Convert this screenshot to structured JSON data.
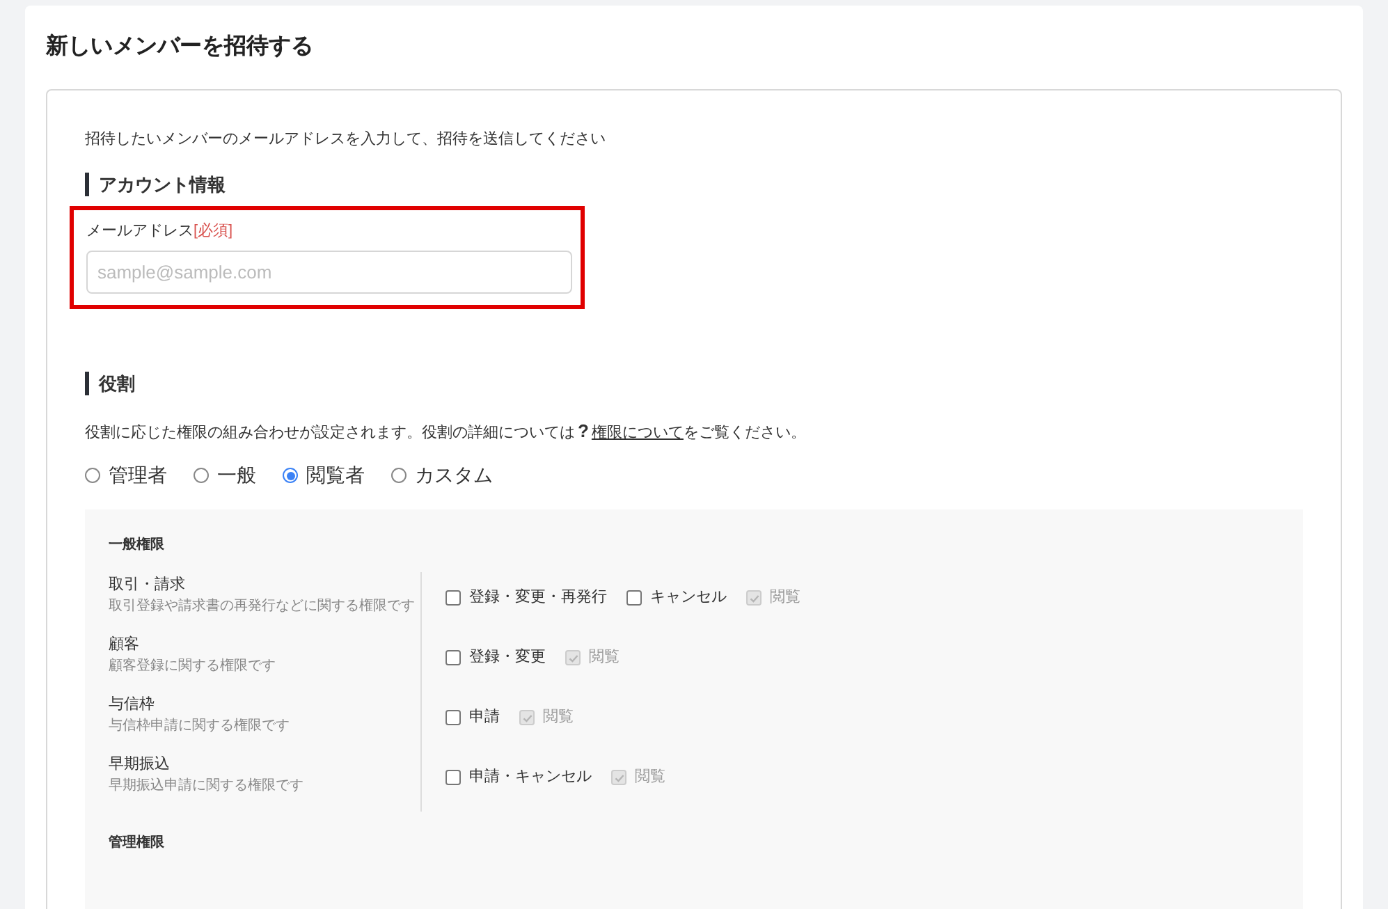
{
  "page": {
    "title": "新しいメンバーを招待する"
  },
  "intro": "招待したいメンバーのメールアドレスを入力して、招待を送信してください",
  "account": {
    "heading": "アカウント情報",
    "email": {
      "label": "メールアドレス",
      "required": "[必須]",
      "placeholder": "sample@sample.com",
      "highlighted": true
    }
  },
  "role": {
    "heading": "役割",
    "description_before": "役割に応じた権限の組み合わせが設定されます。役割の詳細については",
    "help_mark": "?",
    "link": "権限について",
    "description_after": "をご覧ください。",
    "options": [
      {
        "label": "管理者",
        "selected": false
      },
      {
        "label": "一般",
        "selected": false
      },
      {
        "label": "閲覧者",
        "selected": true
      },
      {
        "label": "カスタム",
        "selected": false
      }
    ]
  },
  "permissions": {
    "general_heading": "一般権限",
    "rows": [
      {
        "name": "取引・請求",
        "description": "取引登録や請求書の再発行などに関する権限です",
        "options": [
          {
            "label": "登録・変更・再発行",
            "checked": false,
            "disabled": false
          },
          {
            "label": "キャンセル",
            "checked": false,
            "disabled": false
          },
          {
            "label": "閲覧",
            "checked": true,
            "disabled": true
          }
        ]
      },
      {
        "name": "顧客",
        "description": "顧客登録に関する権限です",
        "options": [
          {
            "label": "登録・変更",
            "checked": false,
            "disabled": false
          },
          {
            "label": "閲覧",
            "checked": true,
            "disabled": true
          }
        ]
      },
      {
        "name": "与信枠",
        "description": "与信枠申請に関する権限です",
        "options": [
          {
            "label": "申請",
            "checked": false,
            "disabled": false
          },
          {
            "label": "閲覧",
            "checked": true,
            "disabled": true
          }
        ]
      },
      {
        "name": "早期振込",
        "description": "早期振込申請に関する権限です",
        "options": [
          {
            "label": "申請・キャンセル",
            "checked": false,
            "disabled": false
          },
          {
            "label": "閲覧",
            "checked": true,
            "disabled": true
          }
        ]
      }
    ],
    "admin_heading": "管理権限"
  }
}
